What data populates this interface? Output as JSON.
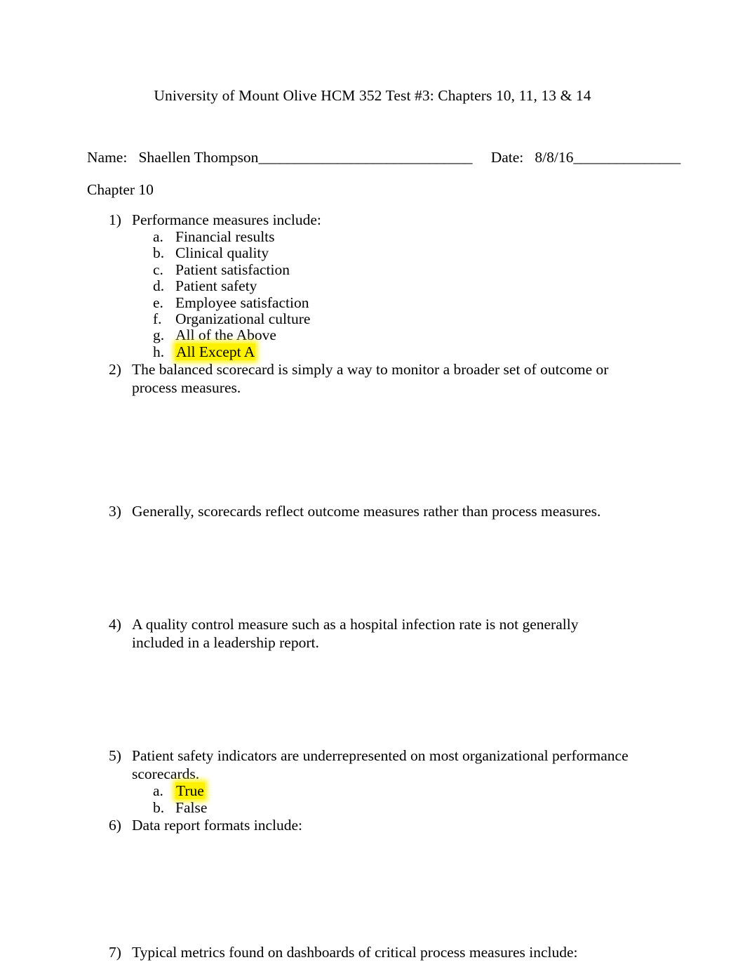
{
  "document": {
    "title": "University of Mount Olive HCM 352 Test #3: Chapters 10, 11, 13 & 14",
    "chapter_heading": "Chapter 10",
    "highlight_color": "#FFF200"
  },
  "identification": {
    "name_label": "Name:",
    "name_value": "Shaellen Thompson",
    "name_rule": "______________________________",
    "date_label": "Date:",
    "date_value": "8/8/16",
    "date_rule": "_______________"
  },
  "questions": [
    {
      "number": "1)",
      "text": "Performance measures include:",
      "options": [
        {
          "label": "a.",
          "text": "Financial results",
          "highlighted": false
        },
        {
          "label": "b.",
          "text": "Clinical quality",
          "highlighted": false
        },
        {
          "label": "c.",
          "text": "Patient satisfaction",
          "highlighted": false
        },
        {
          "label": "d.",
          "text": "Patient safety",
          "highlighted": false
        },
        {
          "label": "e.",
          "text": "Employee satisfaction",
          "highlighted": false
        },
        {
          "label": "f.",
          "text": "Organizational culture",
          "highlighted": false
        },
        {
          "label": "g.",
          "text": "All of the Above",
          "highlighted": false
        },
        {
          "label": "h.",
          "text": "All Except A",
          "highlighted": true
        }
      ]
    },
    {
      "number": "2)",
      "text": "The balanced scorecard is simply a way to monitor a broader set of outcome or process measures.",
      "options": []
    },
    {
      "number": "3)",
      "text": "Generally, scorecards reflect outcome measures rather than process measures.",
      "options": []
    },
    {
      "number": "4)",
      "text": "A quality control measure such as a hospital infection rate is not generally included in a leadership report.",
      "options": []
    },
    {
      "number": "5)",
      "text": "Patient safety indicators are underrepresented on most organizational performance scorecards.",
      "options": [
        {
          "label": "a.",
          "text": "True",
          "highlighted": true
        },
        {
          "label": "b.",
          "text": "False",
          "highlighted": false
        }
      ]
    },
    {
      "number": "6)",
      "text": "Data report formats include:",
      "options": []
    },
    {
      "number": "7)",
      "text": "Typical metrics found on dashboards of critical process measures include:",
      "options": []
    }
  ]
}
